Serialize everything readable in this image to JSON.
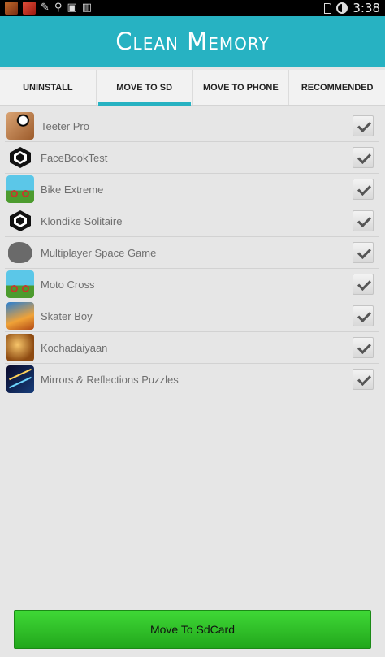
{
  "status_bar": {
    "time": "3:38"
  },
  "header": {
    "title": "Clean Memory",
    "accent_color": "#27b2c2"
  },
  "tabs": [
    {
      "label": "UNINSTALL",
      "active": false
    },
    {
      "label": "MOVE TO SD",
      "active": true
    },
    {
      "label": "MOVE TO PHONE",
      "active": false
    },
    {
      "label": "RECOMMENDED",
      "active": false
    }
  ],
  "apps": [
    {
      "name": "Teeter Pro",
      "icon": "teeter-pro-icon",
      "checked": true
    },
    {
      "name": "FaceBookTest",
      "icon": "unity-icon",
      "checked": true
    },
    {
      "name": "Bike Extreme",
      "icon": "bike-extreme-icon",
      "checked": true
    },
    {
      "name": "Klondike Solitaire",
      "icon": "unity-icon",
      "checked": true
    },
    {
      "name": "Multiplayer Space Game",
      "icon": "space-game-icon",
      "checked": true
    },
    {
      "name": "Moto Cross",
      "icon": "moto-cross-icon",
      "checked": true
    },
    {
      "name": "Skater Boy",
      "icon": "skater-boy-icon",
      "checked": true
    },
    {
      "name": "Kochadaiyaan",
      "icon": "kochadaiyaan-icon",
      "checked": true
    },
    {
      "name": "Mirrors & Reflections Puzzles",
      "icon": "mirrors-icon",
      "checked": true
    }
  ],
  "action_button": {
    "label": "Move To SdCard",
    "color": "#2fc228"
  }
}
